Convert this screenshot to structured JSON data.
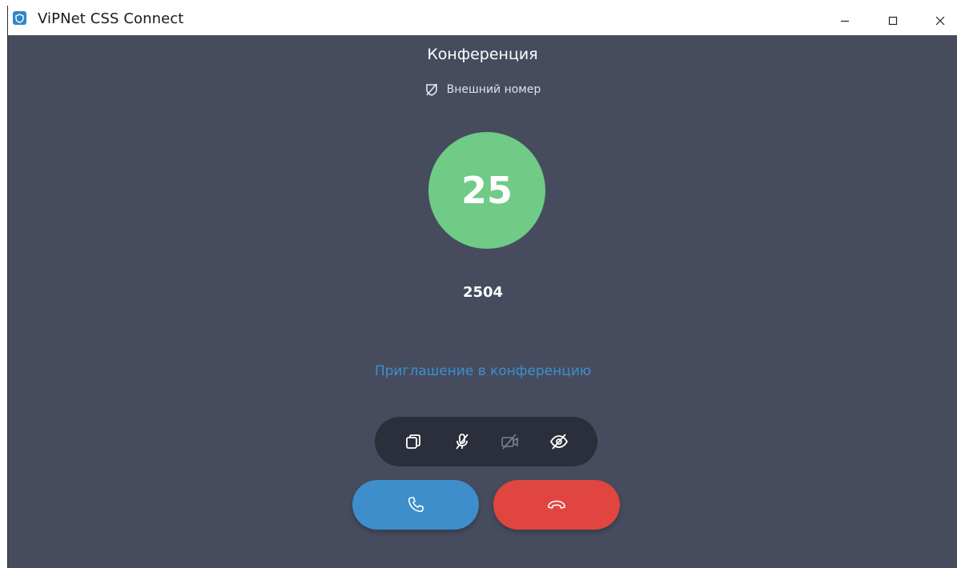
{
  "window": {
    "title": "ViPNet CSS Connect",
    "app_icon": "vipnet-shield-icon",
    "controls": [
      "minimize-icon",
      "maximize-icon",
      "close-icon"
    ]
  },
  "call": {
    "title": "Конференция",
    "external_label": "Внешний номер",
    "external_icon": "shield-off-icon",
    "avatar_text": "25",
    "avatar_color": "#6fcb86",
    "number": "2504",
    "invite_link": "Приглашение в конференцию"
  },
  "toolbar": {
    "buttons": [
      {
        "icon": "windows-copy-icon"
      },
      {
        "icon": "mic-off-icon"
      },
      {
        "icon": "video-off-icon"
      },
      {
        "icon": "eye-off-icon"
      }
    ]
  },
  "actions": {
    "accept_icon": "phone-icon",
    "accept_color": "#3d8ecb",
    "decline_icon": "hang-up-icon",
    "decline_color": "#e0463f"
  },
  "colors": {
    "background": "#464c5e",
    "toolbar": "#2b2f3b",
    "link": "#3c8fd0"
  }
}
